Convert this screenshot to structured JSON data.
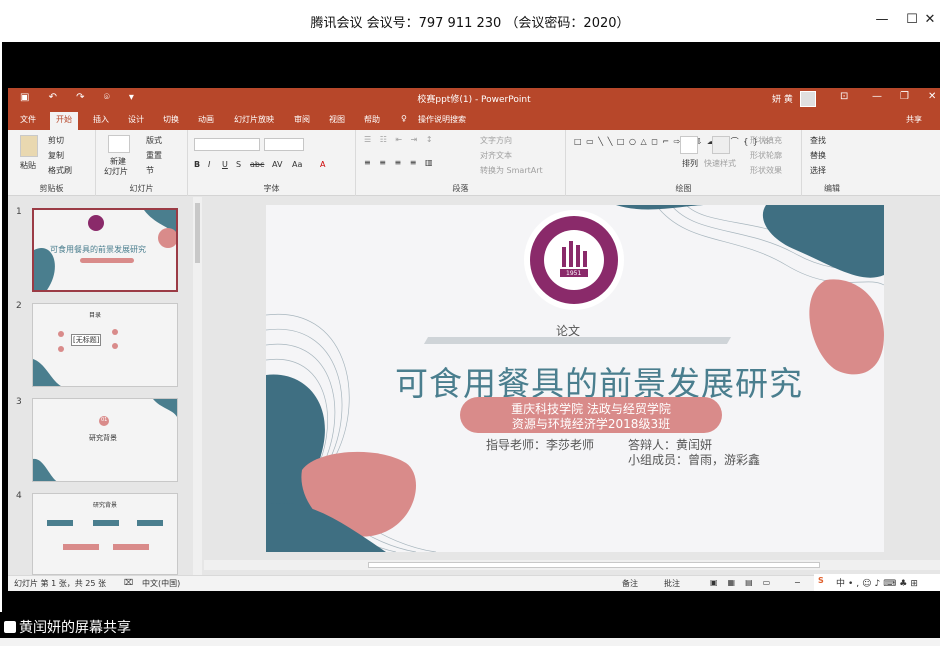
{
  "meeting": {
    "title": "腾讯会议 会议号：797 911 230 （会议密码：2020）",
    "controls": {
      "minimize": "—",
      "maximize": "☐",
      "close": "✕"
    },
    "share_label": "黄闰妍的屏幕共享"
  },
  "ppt": {
    "doc_title": "校赛ppt修(1) - PowerPoint",
    "user_name": "妍 黄",
    "tabs": [
      "文件",
      "开始",
      "插入",
      "设计",
      "切换",
      "动画",
      "幻灯片放映",
      "审阅",
      "视图",
      "帮助"
    ],
    "active_tab": "开始",
    "tell_me": "操作说明搜索",
    "share": "共享",
    "ribbon": {
      "clipboard": {
        "label": "剪贴板",
        "paste": "粘贴",
        "cut": "剪切",
        "copy": "复制",
        "format_painter": "格式刷"
      },
      "slides": {
        "label": "幻灯片",
        "new_slide": "新建",
        "new_slide2": "幻灯片",
        "layout": "版式",
        "reset": "重置",
        "section": "节"
      },
      "font": {
        "label": "字体",
        "bold": "B",
        "italic": "I",
        "underline": "U",
        "shadow": "S",
        "strike": "abc",
        "spacing": "AV",
        "case": "Aa",
        "color": "A"
      },
      "paragraph": {
        "label": "段落",
        "text_direction": "文字方向",
        "align_text": "对齐文本",
        "smartart": "转换为 SmartArt"
      },
      "drawing": {
        "label": "绘图",
        "arrange": "排列",
        "quick_styles": "快速样式",
        "shape_fill": "形状填充",
        "shape_outline": "形状轮廓",
        "shape_effects": "形状效果"
      },
      "editing": {
        "label": "编辑",
        "find": "查找",
        "replace": "替换",
        "select": "选择"
      }
    },
    "thumbnails": [
      {
        "num": "1",
        "title": "可食用餐具的前景发展研究"
      },
      {
        "num": "2",
        "title": "目录",
        "tooltip": "[无标题]"
      },
      {
        "num": "3",
        "title": "研究背景",
        "badge": "01"
      },
      {
        "num": "4",
        "title": "研究背景"
      }
    ],
    "slide": {
      "label": "论文",
      "title": "可食用餐具的前景发展研究",
      "school_line1": "重庆科技学院   法政与经贸学院",
      "school_line2": "资源与环境经济学2018级3班",
      "advisor": "指导老师：李莎老师",
      "defender": "答辩人：黄闰妍",
      "members": "小组成员：曾雨，游彩鑫",
      "logo_year": "1951"
    },
    "status": {
      "slide_info": "幻灯片 第 1 张，共 25 张",
      "language": "中文(中国)",
      "notes": "备注",
      "comments": "批注"
    }
  },
  "colors": {
    "ppt_red": "#b7472a",
    "teal": "#4a7e8e",
    "pink": "#d98b8a",
    "logo_purple": "#8a2a6a"
  }
}
